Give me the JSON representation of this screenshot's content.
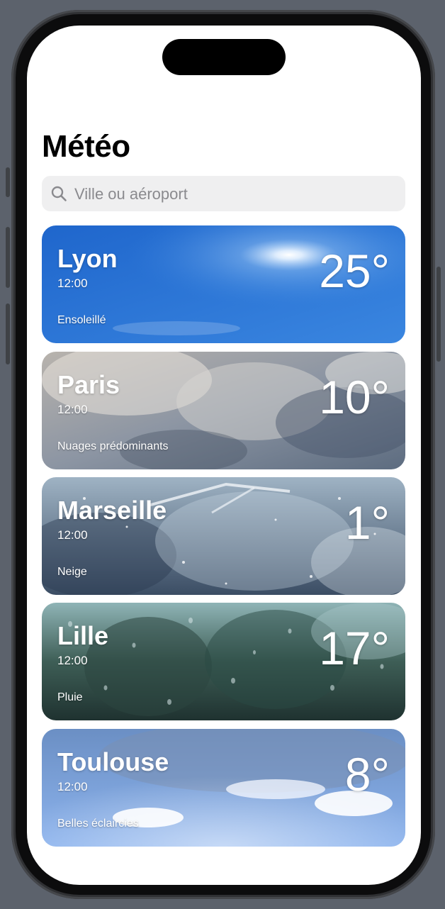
{
  "app": {
    "title": "Météo"
  },
  "search": {
    "placeholder": "Ville ou aéroport",
    "value": ""
  },
  "cities": [
    {
      "name": "Lyon",
      "time": "12:00",
      "condition": "Ensoleillé",
      "temperature": "25°",
      "theme": "sunny"
    },
    {
      "name": "Paris",
      "time": "12:00",
      "condition": "Nuages prédominants",
      "temperature": "10°",
      "theme": "cloudy"
    },
    {
      "name": "Marseille",
      "time": "12:00",
      "condition": "Neige",
      "temperature": "1°",
      "theme": "snow"
    },
    {
      "name": "Lille",
      "time": "12:00",
      "condition": "Pluie",
      "temperature": "17°",
      "theme": "rain"
    },
    {
      "name": "Toulouse",
      "time": "12:00",
      "condition": "Belles éclaircies",
      "temperature": "8°",
      "theme": "partly-cloudy"
    }
  ],
  "colors": {
    "sunny": "#2f78d8",
    "cloudy": "#8a8f9a",
    "snow": "#6d8196",
    "rain": "#3b5a58",
    "partly-cloudy": "#6f96d4"
  }
}
